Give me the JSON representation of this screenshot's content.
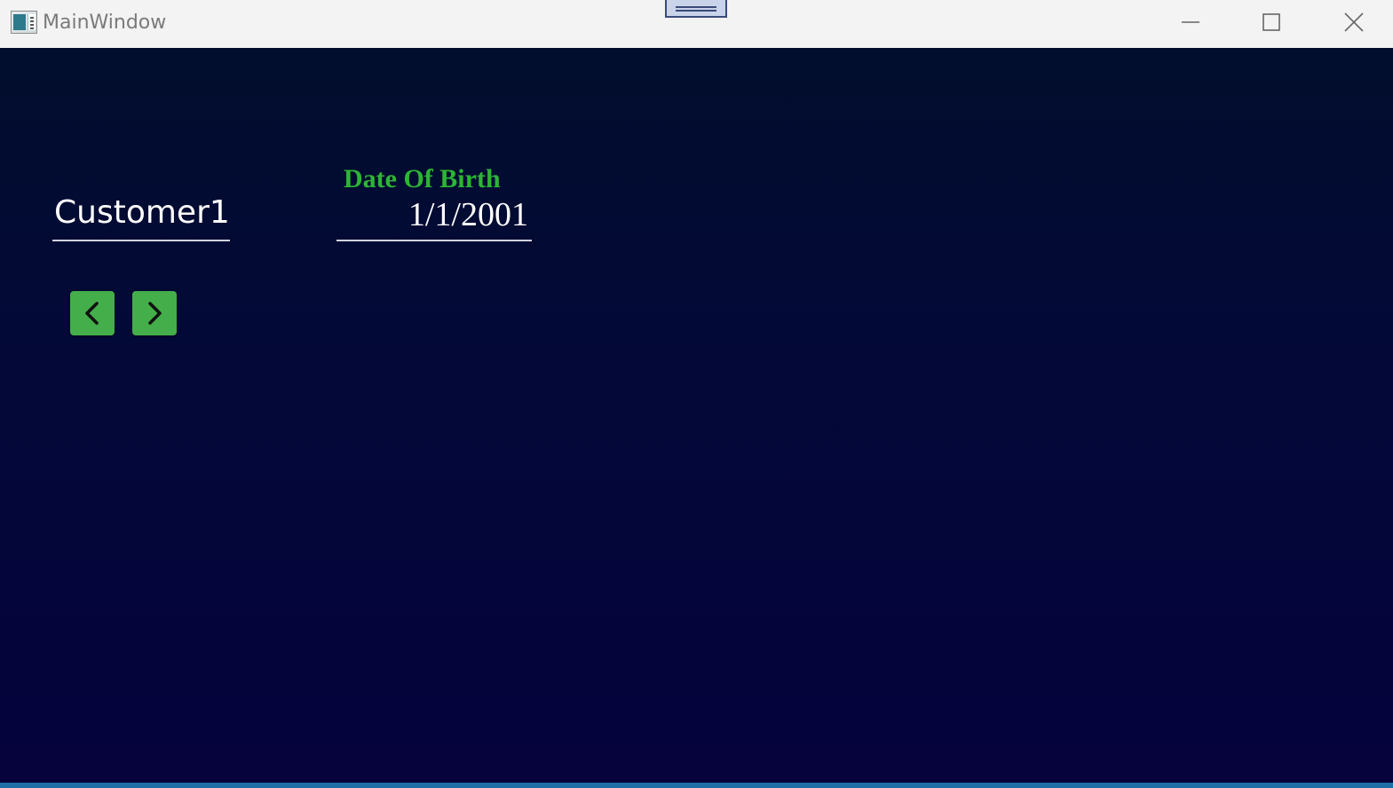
{
  "window": {
    "title": "MainWindow",
    "icon": "app-window-icon",
    "controls": {
      "minimize_icon": "minimize-icon",
      "maximize_icon": "maximize-icon",
      "close_icon": "close-icon"
    }
  },
  "form": {
    "customer_name": "Customer1",
    "date_of_birth_label": "Date Of Birth",
    "date_of_birth": "1/1/2001"
  },
  "navigation": {
    "previous_icon": "chevron-left-icon",
    "next_icon": "chevron-right-icon"
  },
  "colors": {
    "background_top": "#020e2d",
    "background_bottom": "#05023c",
    "label_green": "#2db534",
    "button_green": "#44ae4a",
    "text_white": "#ffffff"
  }
}
